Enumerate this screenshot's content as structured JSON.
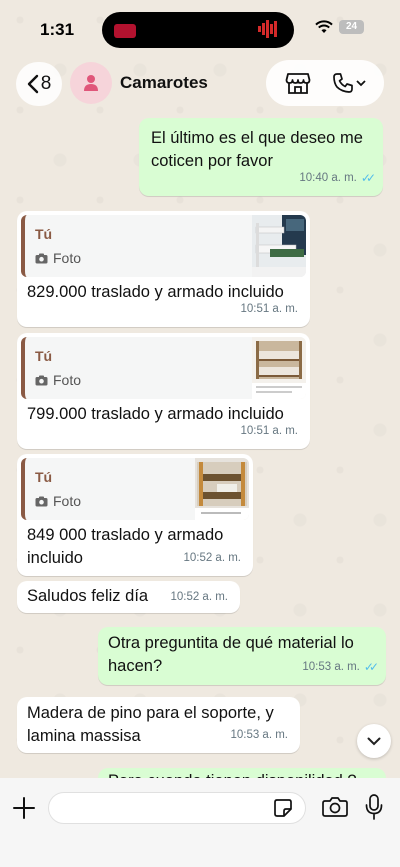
{
  "status": {
    "time": "1:31",
    "battery": "24"
  },
  "header": {
    "back_count": "8",
    "contact_name": "Camarotes"
  },
  "messages": [
    {
      "dir": "out",
      "text": "El último es el que deseo me coticen por favor",
      "time": "10:40 a. m."
    },
    {
      "dir": "in",
      "reply_who": "Tú",
      "reply_kind": "Foto",
      "text": "829.000 traslado y armado incluido",
      "time": "10:51 a. m."
    },
    {
      "dir": "in",
      "reply_who": "Tú",
      "reply_kind": "Foto",
      "text": "799.000 traslado y armado incluido",
      "time": "10:51 a. m."
    },
    {
      "dir": "in",
      "reply_who": "Tú",
      "reply_kind": "Foto",
      "text": "849 000 traslado y armado incluido",
      "time": "10:52 a. m."
    },
    {
      "dir": "in",
      "text": "Saludos feliz día",
      "time": "10:52 a. m."
    },
    {
      "dir": "out",
      "text": "Otra preguntita de qué material lo hacen?",
      "time": "10:53 a. m."
    },
    {
      "dir": "in",
      "text": "Madera de pino para el soporte, y lamina massisa",
      "time": "10:53 a. m."
    },
    {
      "dir": "out",
      "text": "Para cuando tienen disponilidad ?",
      "time": ""
    }
  ],
  "icons": {
    "back": "chevron-left-icon",
    "avatar": "person-icon",
    "store": "store-icon",
    "call": "phone-icon",
    "photo": "camera-small-icon",
    "plus": "plus-icon",
    "sticker": "sticker-icon",
    "camera": "camera-icon",
    "mic": "microphone-icon",
    "scroll": "chevron-down-icon",
    "read": "double-check-icon"
  },
  "colors": {
    "outgoing": "#d9fdd3",
    "incoming": "#ffffff",
    "reply_accent": "#8a5a44",
    "read_ticks": "#53bdeb"
  }
}
